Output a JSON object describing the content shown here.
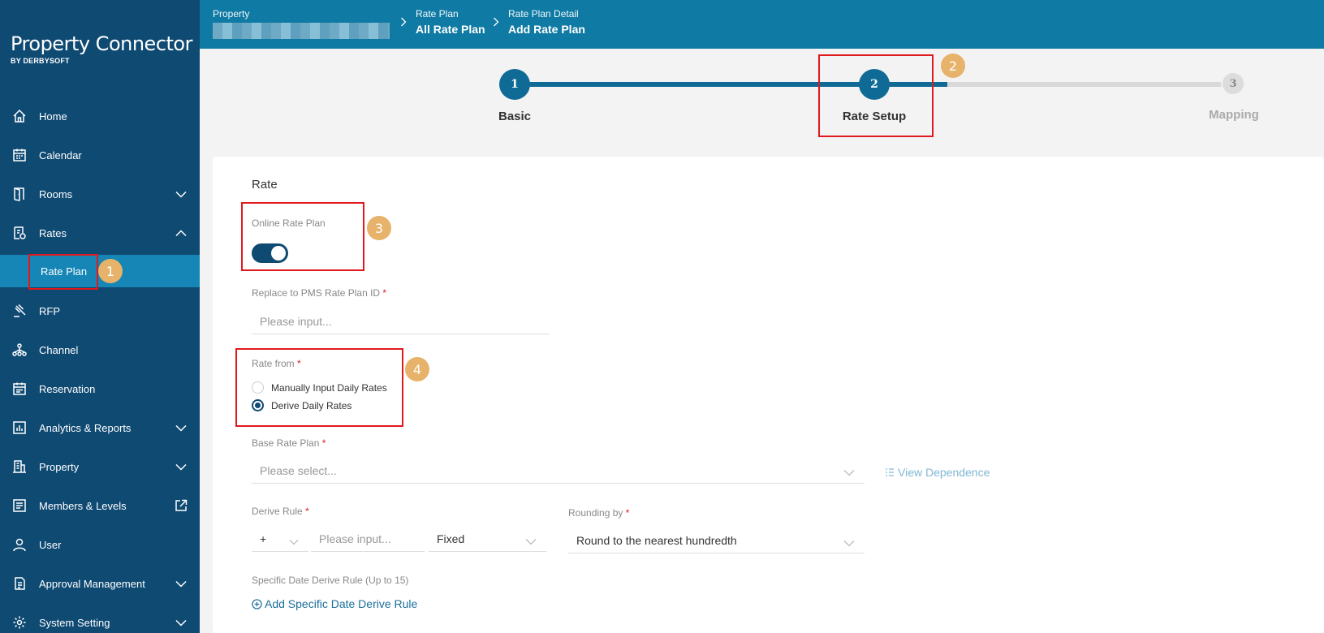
{
  "brand": {
    "title": "Property Connector",
    "subtitle": "BY DERBYSOFT"
  },
  "sidebar": {
    "items": [
      {
        "label": "Home",
        "icon": "home-icon"
      },
      {
        "label": "Calendar",
        "icon": "calendar-icon"
      },
      {
        "label": "Rooms",
        "icon": "door-icon"
      },
      {
        "label": "Rates",
        "icon": "rates-icon"
      },
      {
        "label": "Rate Plan"
      },
      {
        "label": "RFP",
        "icon": "gavel-icon"
      },
      {
        "label": "Channel",
        "icon": "network-icon"
      },
      {
        "label": "Reservation",
        "icon": "reservation-icon"
      },
      {
        "label": "Analytics & Reports",
        "icon": "chart-icon"
      },
      {
        "label": "Property",
        "icon": "building-icon"
      },
      {
        "label": "Members & Levels",
        "icon": "members-icon"
      },
      {
        "label": "User",
        "icon": "user-icon"
      },
      {
        "label": "Approval Management",
        "icon": "approval-icon"
      },
      {
        "label": "System Setting",
        "icon": "gear-icon"
      }
    ]
  },
  "header": {
    "crumbs": [
      {
        "top": "Property",
        "main": ""
      },
      {
        "top": "Rate Plan",
        "main": "All Rate Plan"
      },
      {
        "top": "Rate Plan Detail",
        "main": "Add Rate Plan"
      }
    ]
  },
  "stepper": {
    "steps": [
      {
        "num": "1",
        "label": "Basic"
      },
      {
        "num": "2",
        "label": "Rate Setup"
      },
      {
        "num": "3",
        "label": "Mapping"
      }
    ]
  },
  "badges": [
    "1",
    "2",
    "3",
    "4"
  ],
  "form": {
    "section_title": "Rate",
    "online_rate_plan_label": "Online Rate Plan",
    "replace_pms_label": "Replace to PMS Rate Plan ID",
    "replace_pms_placeholder": "Please input...",
    "rate_from_label": "Rate from",
    "rate_from_options": [
      "Manually Input Daily Rates",
      "Derive Daily Rates"
    ],
    "rate_from_selected": "Derive Daily Rates",
    "base_rate_plan_label": "Base Rate Plan",
    "base_rate_plan_placeholder": "Please select...",
    "view_dependence": "View Dependence",
    "derive_rule_label": "Derive Rule",
    "derive_operator": "+",
    "derive_value_placeholder": "Please input...",
    "derive_type": "Fixed",
    "rounding_label": "Rounding by",
    "rounding_value": "Round to the nearest hundredth",
    "specific_date_label": "Specific Date Derive Rule (Up to 15)",
    "add_specific_link": "Add Specific Date Derive Rule",
    "required_mark": "*"
  },
  "colors": {
    "sidebar": "#0f4a73",
    "header": "#0f7aa3",
    "active": "#1586b5",
    "highlight": "#e0191e",
    "badge": "#e7b26a"
  }
}
